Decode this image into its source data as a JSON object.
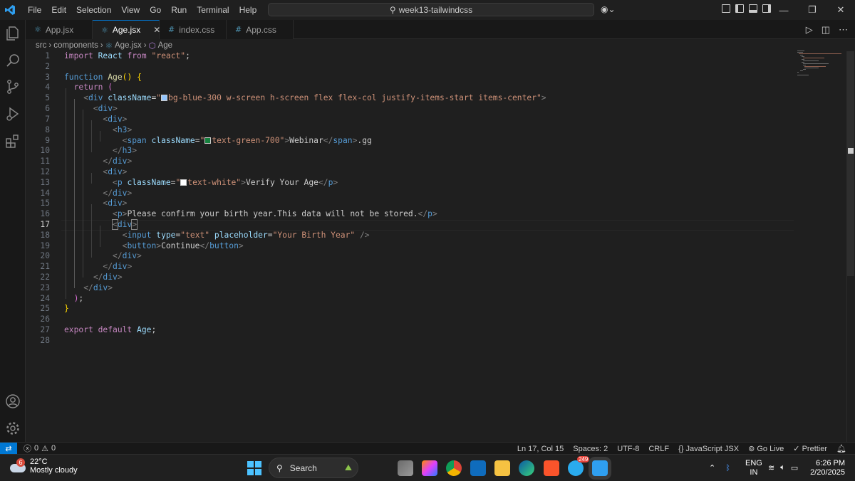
{
  "menu": [
    "File",
    "Edit",
    "Selection",
    "View",
    "Go",
    "Run",
    "Terminal",
    "Help"
  ],
  "search_box": "week13-tailwindcss",
  "tabs": [
    {
      "icon": "⚛",
      "label": "App.jsx",
      "icon_color": "#519aba"
    },
    {
      "icon": "⚛",
      "label": "Age.jsx",
      "icon_color": "#519aba",
      "active": true
    },
    {
      "icon": "#",
      "label": "index.css",
      "icon_color": "#519aba"
    },
    {
      "icon": "#",
      "label": "App.css",
      "icon_color": "#519aba"
    }
  ],
  "breadcrumb": {
    "a": "src",
    "b": "components",
    "c": "Age.jsx",
    "d": "Age"
  },
  "code_lines": [
    "1",
    "2",
    "3",
    "4",
    "5",
    "6",
    "7",
    "8",
    "9",
    "10",
    "11",
    "12",
    "13",
    "14",
    "15",
    "16",
    "17",
    "18",
    "19",
    "20",
    "21",
    "22",
    "23",
    "24",
    "25",
    "26",
    "27",
    "28"
  ],
  "colors": {
    "bg_blue_300": "#93c5fd",
    "text_green_700": "#15803d",
    "text_white": "#ffffff",
    "accent": "#0078d4"
  },
  "statusbar": {
    "errors": "0",
    "warnings": "0",
    "position": "Ln 17, Col 15",
    "spaces": "Spaces: 2",
    "encoding": "UTF-8",
    "eol": "CRLF",
    "language": "{} JavaScript JSX",
    "golive": "Go Live",
    "prettier": "✓ Prettier"
  },
  "taskbar": {
    "weather_badge": "6",
    "temperature": "22°C",
    "weather_desc": "Mostly cloudy",
    "search_label": "Search",
    "telegram_badge": "249",
    "lang1": "ENG",
    "lang2": "IN",
    "time": "6:26 PM",
    "date": "2/20/2025"
  }
}
